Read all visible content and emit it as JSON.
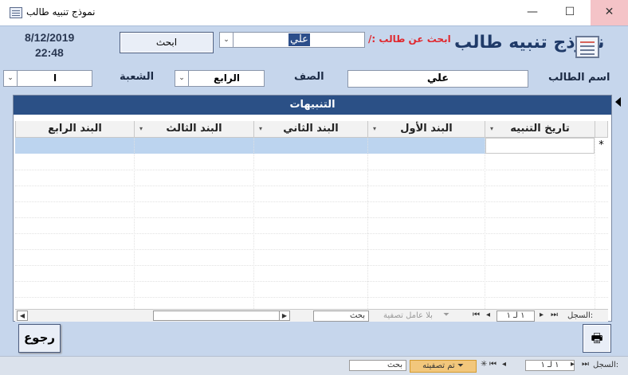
{
  "window": {
    "title": "نموذج تنبيه طالب",
    "controls": {
      "minimize": "—",
      "maximize": "☐",
      "close": "✕"
    }
  },
  "header": {
    "heading": "نموذج تنبيه طالب",
    "date": "8/12/2019",
    "time": "22:48",
    "search_label": "ابحث عن طالب :/",
    "search_value": "علي",
    "search_button": "ابحث"
  },
  "student": {
    "name_label": "اسم الطالب",
    "name_value": "علي",
    "class_label": "الصف",
    "class_value": "الرابع",
    "section_label": "الشعبة",
    "section_value": "ا"
  },
  "subform": {
    "title": "التنبيهات",
    "columns": [
      "تاريخ التنبيه",
      "البند الأول",
      "البند الثاني",
      "البند الثالث",
      "البند الرابع"
    ],
    "new_row_marker": "*",
    "nav": {
      "record_label": "السجل:",
      "record_value": "١ لـ ١",
      "filter_label": "بلا عامل تصفية",
      "search_label": "بحث"
    }
  },
  "footer": {
    "back_button": "رجوع",
    "record_label": "السجل:",
    "record_value": "١ لـ ١",
    "filter_label": "تم تصفيته",
    "search_label": "بحث"
  },
  "icons": [
    "form-icon",
    "printer-icon",
    "filter-icon"
  ]
}
